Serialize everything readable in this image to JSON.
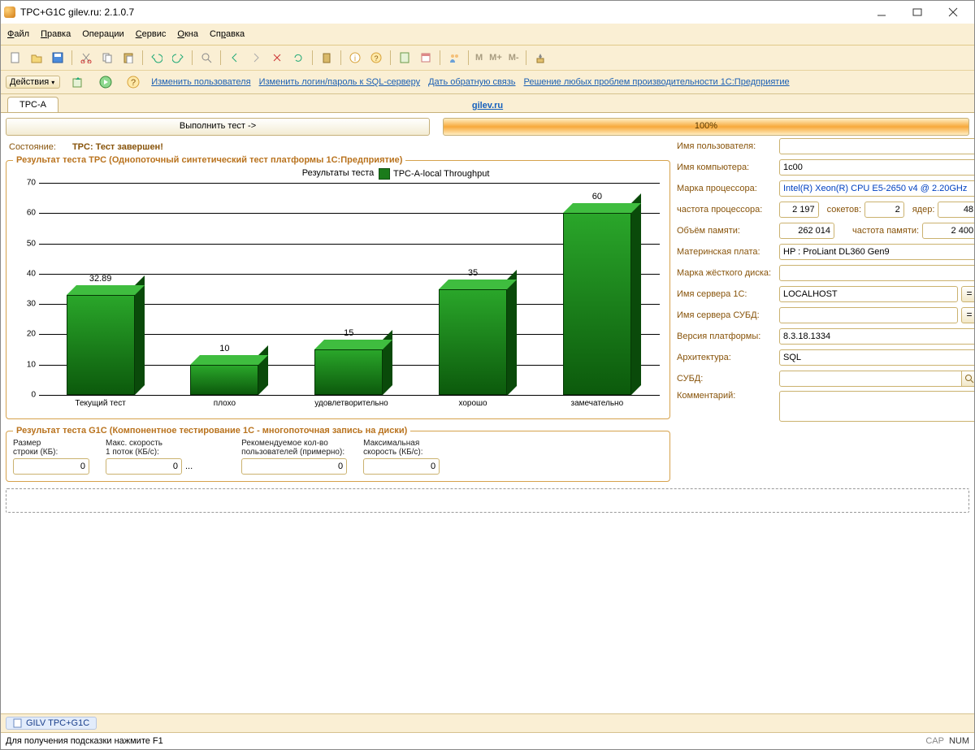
{
  "window_title": "TPC+G1C gilev.ru: 2.1.0.7",
  "menus": [
    "Файл",
    "Правка",
    "Операции",
    "Сервис",
    "Окна",
    "Справка"
  ],
  "toolbar2": {
    "actions_label": "Действия",
    "links": [
      "Изменить пользователя",
      "Изменить логин/пароль к SQL-серверу",
      "Дать обратную связь",
      "Решение любых проблем производительности 1С:Предприятие"
    ]
  },
  "tab_name": "TPC-A",
  "header_link": "gilev.ru",
  "run_button": "Выполнить тест ->",
  "progress_text": "100%",
  "status_label": "Состояние:",
  "status_value": "TPC: Тест завершен!",
  "tpc_legend": "Результат теста TPC (Однопоточный синтетический тест платформы 1С:Предприятие)",
  "chart_title": "Результаты теста",
  "chart_series": "TPC-A-local Throughput",
  "g1c_legend": "Результат теста G1C (Компонентное тестирование 1С - многопоточная запись на диски)",
  "g1c": {
    "c1_lbl": "Размер\nстроки (КБ):",
    "c1_val": "0",
    "c2_lbl": "Макс. скорость\n1 поток (КБ/с):",
    "c2_val": "0",
    "c2_suffix": "...",
    "c3_lbl": "Рекомендуемое кол-во\nпользователей (примерно):",
    "c3_val": "0",
    "c4_lbl": "Максимальная\nскорость (КБ/с):",
    "c4_val": "0"
  },
  "props": {
    "user_lbl": "Имя пользователя:",
    "user": "",
    "comp_lbl": "Имя компьютера:",
    "comp": "1c00",
    "cpu_lbl": "Марка процессора:",
    "cpu": "Intel(R) Xeon(R) CPU E5-2650 v4 @ 2.20GHz",
    "freq_lbl": "частота процессора:",
    "freq": "2 197",
    "sock_lbl": "сокетов:",
    "sock": "2",
    "core_lbl": "ядер:",
    "core": "48",
    "ram_lbl": "Объём памяти:",
    "ram": "262 014",
    "ramf_lbl": "частота памяти:",
    "ramf": "2 400",
    "mb_lbl": "Материнская плата:",
    "mb": "HP : ProLiant DL360 Gen9",
    "hdd_lbl": "Марка жёсткого диска:",
    "hdd": "",
    "srv1c_lbl": "Имя сервера 1С:",
    "srv1c": "LOCALHOST",
    "srvdb_lbl": "Имя сервера СУБД:",
    "srvdb": "",
    "ver_lbl": "Версия платформы:",
    "ver": "8.3.18.1334",
    "arch_lbl": "Архитектура:",
    "arch": "SQL",
    "dbms_lbl": "СУБД:",
    "dbms": "",
    "comm_lbl": "Комментарий:"
  },
  "footer_tab": "GILV TPC+G1C",
  "footer_hint": "Для получения подсказки нажмите F1",
  "caps": "CAP",
  "num": "NUM",
  "chart_data": {
    "type": "bar",
    "title": "Результаты теста",
    "series_name": "TPC-A-local Throughput",
    "categories": [
      "Текущий тест",
      "плохо",
      "удовлетворительно",
      "хорошо",
      "замечательно"
    ],
    "values": [
      32.89,
      10,
      15,
      35,
      60
    ],
    "ylim": [
      0,
      70
    ],
    "ytick": 10
  }
}
